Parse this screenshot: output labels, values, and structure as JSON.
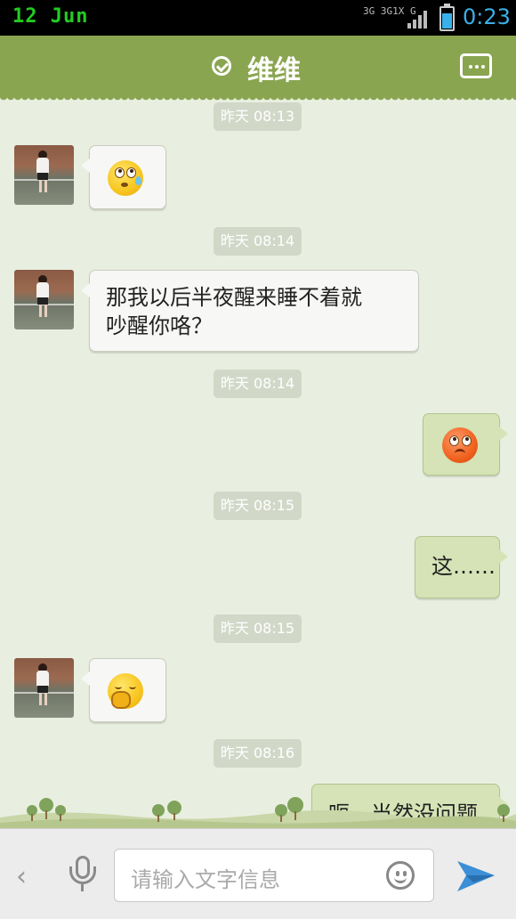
{
  "status_bar": {
    "date": "12 Jun",
    "network": "3G 3G1X G",
    "time": "0:23",
    "battery_level": 0.7
  },
  "header": {
    "title": "维维",
    "verified_icon": "check-circle-icon",
    "menu_icon": "more-icon"
  },
  "messages": [
    {
      "timestamp": "昨天 08:13",
      "side": "left",
      "type": "emoji",
      "emoji": "sweat-face"
    },
    {
      "timestamp": "昨天 08:14",
      "side": "left",
      "type": "text",
      "lines": [
        "那我以后半夜醒来睡不着就",
        "吵醒你咯？"
      ]
    },
    {
      "timestamp": "昨天 08:14",
      "side": "right",
      "type": "emoji",
      "emoji": "angry-face"
    },
    {
      "timestamp": "昨天 08:15",
      "side": "right",
      "type": "text",
      "text": "这……"
    },
    {
      "timestamp": "昨天 08:15",
      "side": "left",
      "type": "emoji",
      "emoji": "shy-face"
    },
    {
      "timestamp": "昨天 08:16",
      "side": "right",
      "type": "text",
      "text": "呃…当然没问题"
    }
  ],
  "input_bar": {
    "placeholder": "请输入文字信息"
  },
  "colors": {
    "header": "#8aa550",
    "chat_bg": "#e9efe0",
    "bubble_right": "#d5e3b6",
    "bubble_left": "#f7f7f5"
  }
}
